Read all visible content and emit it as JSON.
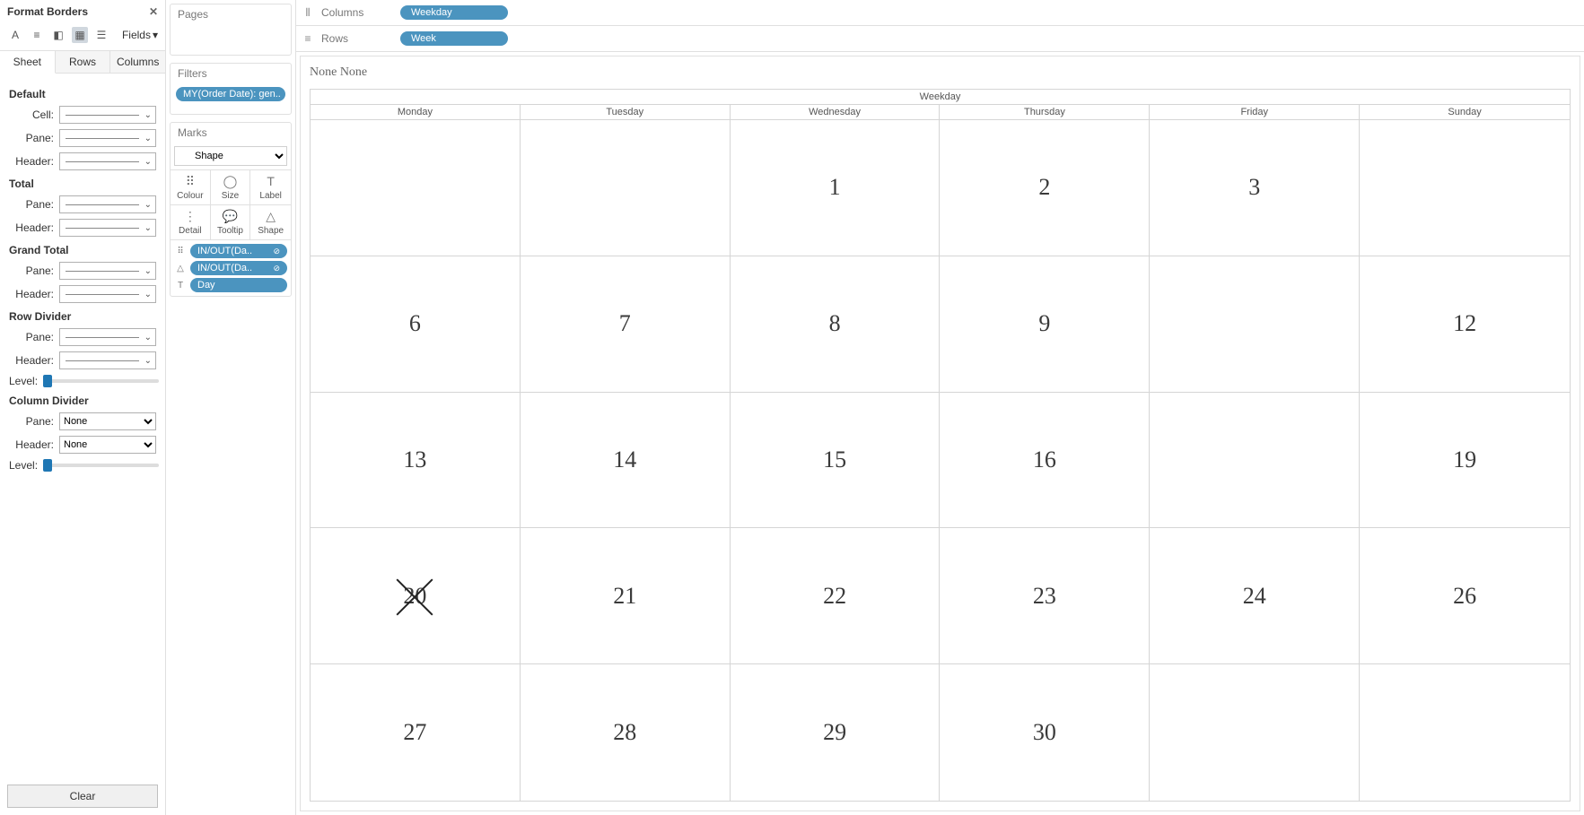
{
  "format": {
    "title": "Format Borders",
    "fields_btn": "Fields",
    "tabs": [
      "Sheet",
      "Rows",
      "Columns"
    ],
    "active_tab": 0,
    "sections": {
      "default": {
        "title": "Default",
        "cell": "Cell:",
        "pane": "Pane:",
        "header": "Header:"
      },
      "total": {
        "title": "Total",
        "pane": "Pane:",
        "header": "Header:"
      },
      "grand_total": {
        "title": "Grand Total",
        "pane": "Pane:",
        "header": "Header:"
      },
      "row_divider": {
        "title": "Row Divider",
        "pane": "Pane:",
        "header": "Header:",
        "level": "Level:"
      },
      "column_divider": {
        "title": "Column Divider",
        "pane": "Pane:",
        "header": "Header:",
        "level": "Level:",
        "pane_val": "None",
        "header_val": "None"
      }
    },
    "clear": "Clear"
  },
  "shelves": {
    "pages": {
      "title": "Pages"
    },
    "filters": {
      "title": "Filters",
      "pill": "MY(Order Date): gen.."
    },
    "marks": {
      "title": "Marks",
      "type": "Shape",
      "buttons": [
        {
          "icon": "⠿",
          "label": "Colour"
        },
        {
          "icon": "◯",
          "label": "Size"
        },
        {
          "icon": "T",
          "label": "Label"
        },
        {
          "icon": "⋮",
          "label": "Detail"
        },
        {
          "icon": "💬",
          "label": "Tooltip"
        },
        {
          "icon": "△",
          "label": "Shape"
        }
      ],
      "pills": [
        {
          "icon": "⠿",
          "label": "IN/OUT(Da..",
          "drop": "⊘"
        },
        {
          "icon": "△",
          "label": "IN/OUT(Da..",
          "drop": "⊘"
        },
        {
          "icon": "T",
          "label": "Day",
          "drop": ""
        }
      ]
    }
  },
  "columns_shelf": {
    "label": "Columns",
    "pill": "Weekday"
  },
  "rows_shelf": {
    "label": "Rows",
    "pill": "Week"
  },
  "viz": {
    "title": "None None",
    "top_header": "Weekday",
    "days": [
      "Monday",
      "Tuesday",
      "Wednesday",
      "Thursday",
      "Friday",
      "Sunday"
    ],
    "grid": [
      [
        "",
        "",
        "1",
        "2",
        "3",
        ""
      ],
      [
        "6",
        "7",
        "8",
        "9",
        "",
        "12"
      ],
      [
        "13",
        "14",
        "15",
        "16",
        "",
        "19"
      ],
      [
        "20",
        "21",
        "22",
        "23",
        "24",
        "26"
      ],
      [
        "27",
        "28",
        "29",
        "30",
        "",
        ""
      ]
    ],
    "crossed": [
      [
        3,
        0
      ]
    ]
  }
}
